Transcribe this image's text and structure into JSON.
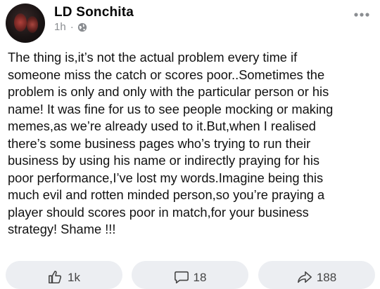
{
  "post": {
    "author": "LD Sonchita",
    "time": "1h",
    "separator": "·",
    "body": "The thing is,it’s not the actual problem every time if\nsomeone miss the catch or scores poor..Sometimes the\nproblem is only and only with the particular person or his\nname! It was fine for us to see people mocking or making\nmemes,as we’re already used to it.But,when I realised\nthere’s some business pages  who’s trying to run their\nbusiness by using his name or indirectly praying for his\npoor performance,I’ve lost my words.Imagine being this\nmuch evil and rotten minded person,so you’re praying a\nplayer should scores poor in match,for your business\nstrategy! Shame !!!"
  },
  "icons": {
    "privacy": "globe-icon",
    "menu": "more-horizontal-icon",
    "like": "thumbs-up-icon",
    "comment": "comment-bubble-icon",
    "share": "share-arrow-icon"
  },
  "actions": {
    "like_count": "1k",
    "comment_count": "18",
    "share_count": "188"
  },
  "colors": {
    "meta_gray": "#8a8d91",
    "pill_bg": "#eceef2"
  }
}
